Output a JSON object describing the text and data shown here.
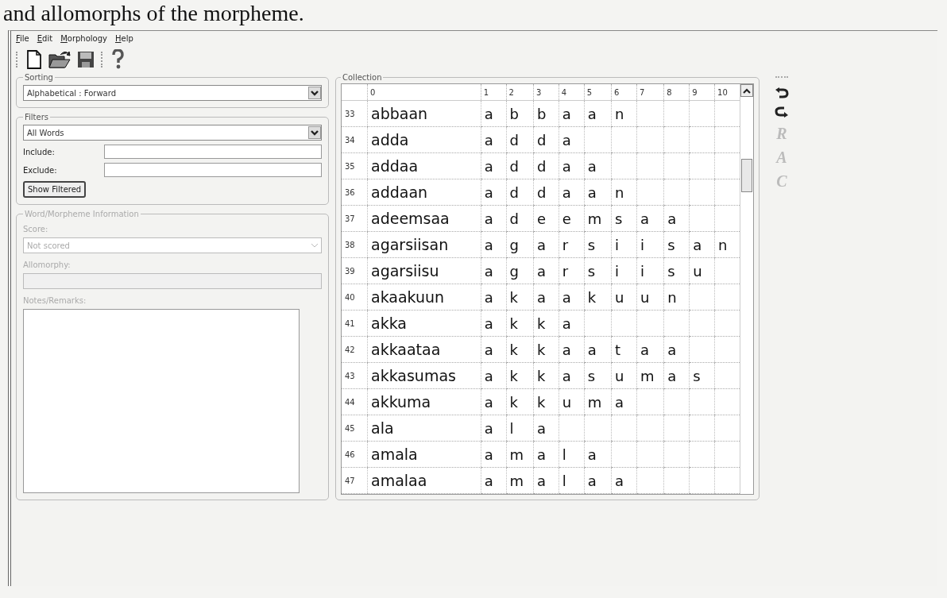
{
  "page_caption": "and allomorphs of the morpheme.",
  "menu": [
    {
      "access": "F",
      "rest": "ile"
    },
    {
      "access": "E",
      "rest": "dit"
    },
    {
      "access": "M",
      "rest": "orphology"
    },
    {
      "access": "H",
      "rest": "elp"
    }
  ],
  "toolbar": [
    {
      "kind": "new"
    },
    {
      "kind": "open"
    },
    {
      "kind": "save"
    },
    {
      "kind": "separator"
    },
    {
      "kind": "help"
    }
  ],
  "sorting": {
    "title": "Sorting",
    "value": "Alphabetical : Forward"
  },
  "filters": {
    "title": "Filters",
    "value": "All Words",
    "include_label": "Include:",
    "exclude_label": "Exclude:",
    "button": "Show Filtered"
  },
  "info": {
    "title": "Word/Morpheme Information",
    "disabled": true,
    "score_label": "Score:",
    "score_value": "Not scored",
    "allomorphy_label": "Allomorphy:",
    "notes_label": "Notes/Remarks:"
  },
  "collection": {
    "title": "Collection",
    "columns": [
      "0",
      "1",
      "2",
      "3",
      "4",
      "5",
      "6",
      "7",
      "8",
      "9",
      "10"
    ],
    "rows": [
      {
        "number": "33",
        "word": "abbaan",
        "letters": [
          "a",
          "b",
          "b",
          "a",
          "a",
          "n"
        ]
      },
      {
        "number": "34",
        "word": "adda",
        "letters": [
          "a",
          "d",
          "d",
          "a"
        ]
      },
      {
        "number": "35",
        "word": "addaa",
        "letters": [
          "a",
          "d",
          "d",
          "a",
          "a"
        ]
      },
      {
        "number": "36",
        "word": "addaan",
        "letters": [
          "a",
          "d",
          "d",
          "a",
          "a",
          "n"
        ]
      },
      {
        "number": "37",
        "word": "adeemsaa",
        "letters": [
          "a",
          "d",
          "e",
          "e",
          "m",
          "s",
          "a",
          "a"
        ]
      },
      {
        "number": "38",
        "word": "agarsiisan",
        "letters": [
          "a",
          "g",
          "a",
          "r",
          "s",
          "i",
          "i",
          "s",
          "a",
          "n"
        ]
      },
      {
        "number": "39",
        "word": "agarsiisu",
        "letters": [
          "a",
          "g",
          "a",
          "r",
          "s",
          "i",
          "i",
          "s",
          "u"
        ]
      },
      {
        "number": "40",
        "word": "akaakuun",
        "letters": [
          "a",
          "k",
          "a",
          "a",
          "k",
          "u",
          "u",
          "n"
        ]
      },
      {
        "number": "41",
        "word": "akka",
        "letters": [
          "a",
          "k",
          "k",
          "a"
        ]
      },
      {
        "number": "42",
        "word": "akkaataa",
        "letters": [
          "a",
          "k",
          "k",
          "a",
          "a",
          "t",
          "a",
          "a"
        ]
      },
      {
        "number": "43",
        "word": "akkasumas",
        "letters": [
          "a",
          "k",
          "k",
          "a",
          "s",
          "u",
          "m",
          "a",
          "s"
        ]
      },
      {
        "number": "44",
        "word": "akkuma",
        "letters": [
          "a",
          "k",
          "k",
          "u",
          "m",
          "a"
        ]
      },
      {
        "number": "45",
        "word": "ala",
        "letters": [
          "a",
          "l",
          "a"
        ]
      },
      {
        "number": "46",
        "word": "amala",
        "letters": [
          "a",
          "m",
          "a",
          "l",
          "a"
        ]
      },
      {
        "number": "47",
        "word": "amalaa",
        "letters": [
          "a",
          "m",
          "a",
          "l",
          "a",
          "a"
        ]
      }
    ]
  },
  "side_tools": [
    {
      "kind": "undo"
    },
    {
      "kind": "redo"
    },
    {
      "kind": "letter",
      "label": "R",
      "disabled": true
    },
    {
      "kind": "letter",
      "label": "A",
      "disabled": true
    },
    {
      "kind": "letter",
      "label": "C",
      "disabled": true
    }
  ]
}
